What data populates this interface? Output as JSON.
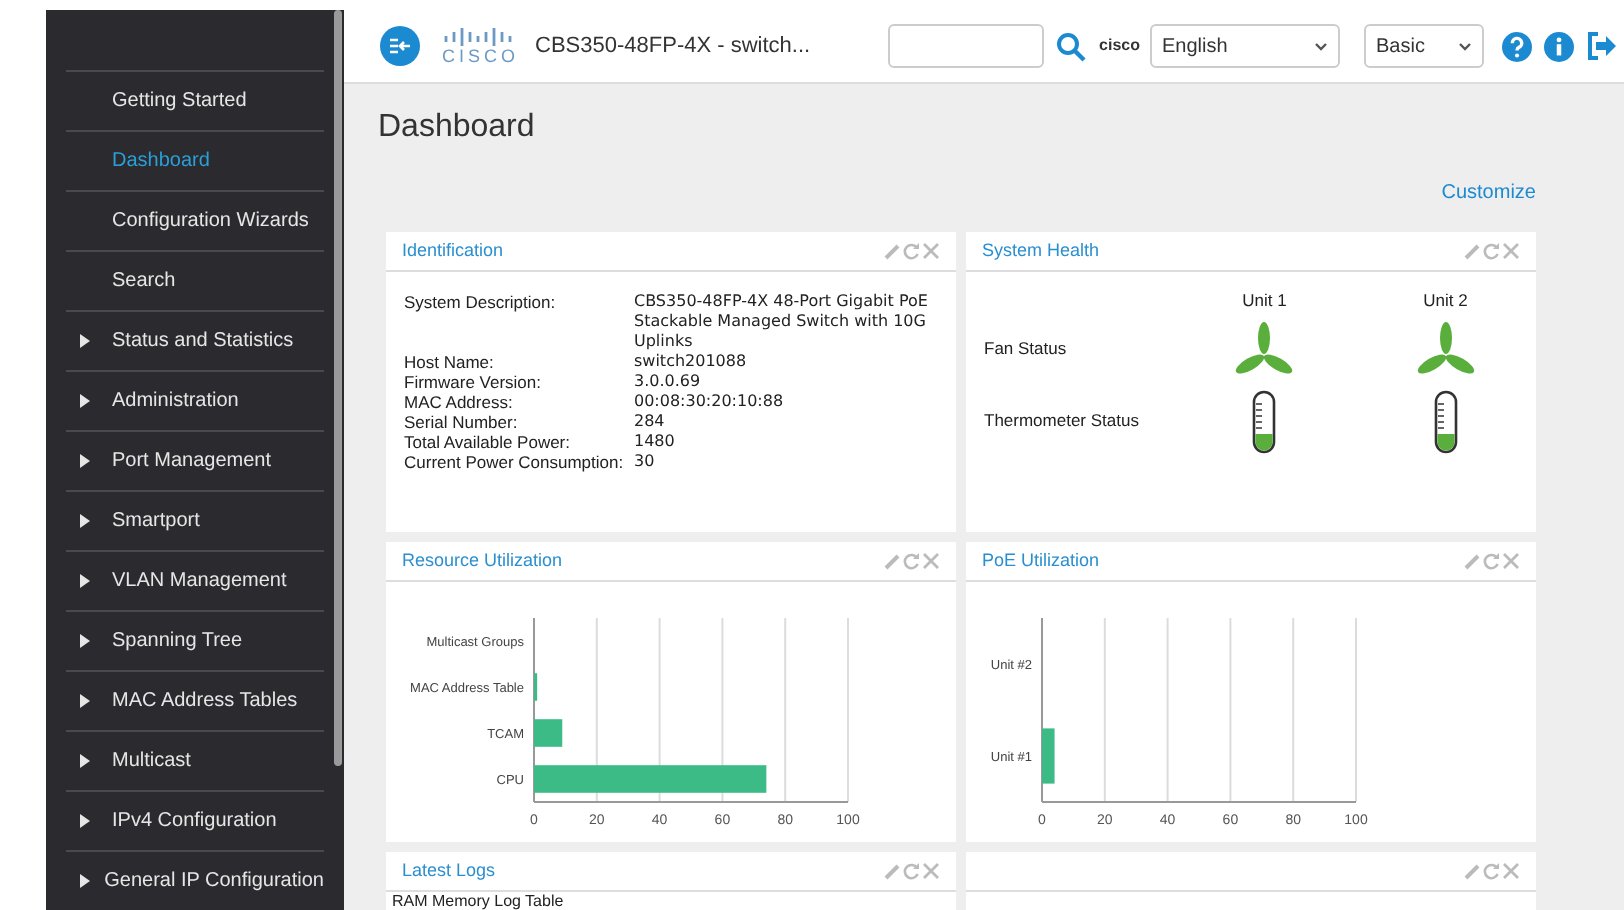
{
  "header": {
    "logo_text": "CISCO",
    "device_title": "CBS350-48FP-4X - switch...",
    "user": "cisco",
    "language": "English",
    "mode": "Basic"
  },
  "sidebar": {
    "items": [
      {
        "label": "Getting Started",
        "has_children": false,
        "selected": false
      },
      {
        "label": "Dashboard",
        "has_children": false,
        "selected": true
      },
      {
        "label": "Configuration Wizards",
        "has_children": false,
        "selected": false
      },
      {
        "label": "Search",
        "has_children": false,
        "selected": false
      },
      {
        "label": "Status and Statistics",
        "has_children": true,
        "selected": false
      },
      {
        "label": "Administration",
        "has_children": true,
        "selected": false
      },
      {
        "label": "Port Management",
        "has_children": true,
        "selected": false
      },
      {
        "label": "Smartport",
        "has_children": true,
        "selected": false
      },
      {
        "label": "VLAN Management",
        "has_children": true,
        "selected": false
      },
      {
        "label": "Spanning Tree",
        "has_children": true,
        "selected": false
      },
      {
        "label": "MAC Address Tables",
        "has_children": true,
        "selected": false
      },
      {
        "label": "Multicast",
        "has_children": true,
        "selected": false
      },
      {
        "label": "IPv4 Configuration",
        "has_children": true,
        "selected": false
      },
      {
        "label": "General IP Configuration",
        "has_children": true,
        "selected": false
      }
    ]
  },
  "page_title": "Dashboard",
  "customize_link": "Customize",
  "identification": {
    "title": "Identification",
    "fields": [
      {
        "label": "System Description:",
        "value": "CBS350-48FP-4X 48-Port Gigabit PoE Stackable Managed Switch with 10G Uplinks"
      },
      {
        "label": "Host Name:",
        "value": "switch201088"
      },
      {
        "label": "Firmware Version:",
        "value": "3.0.0.69"
      },
      {
        "label": "MAC Address:",
        "value": "00:08:30:20:10:88"
      },
      {
        "label": "Serial Number:",
        "value": "284"
      },
      {
        "label": "Total Available Power:",
        "value": "1480"
      },
      {
        "label": "Current Power Consumption:",
        "value": "30"
      }
    ]
  },
  "system_health": {
    "title": "System Health",
    "units": [
      "Unit 1",
      "Unit 2"
    ],
    "rows": [
      {
        "label": "Fan Status",
        "kind": "fan"
      },
      {
        "label": "Thermometer Status",
        "kind": "thermometer"
      }
    ]
  },
  "resource_utilization": {
    "title": "Resource Utilization",
    "chart_data": {
      "type": "bar",
      "orientation": "horizontal",
      "categories": [
        "Multicast Groups",
        "MAC Address Table",
        "TCAM",
        "CPU"
      ],
      "series": [
        {
          "color": "#3dbb86",
          "values": [
            0,
            1,
            9,
            74
          ]
        }
      ],
      "xlim": [
        0,
        100
      ],
      "xticks": [
        0,
        20,
        40,
        60,
        80,
        100
      ],
      "grid": true
    }
  },
  "poe_utilization": {
    "title": "PoE Utilization",
    "chart_data": {
      "type": "bar",
      "orientation": "horizontal",
      "categories": [
        "Unit #2",
        "Unit #1"
      ],
      "series": [
        {
          "color": "#3dbb86",
          "values": [
            0,
            4
          ]
        }
      ],
      "xlim": [
        0,
        100
      ],
      "xticks": [
        0,
        20,
        40,
        60,
        80,
        100
      ],
      "grid": true
    }
  },
  "latest_logs": {
    "title": "Latest Logs",
    "first_line": "RAM Memory Log Table"
  }
}
